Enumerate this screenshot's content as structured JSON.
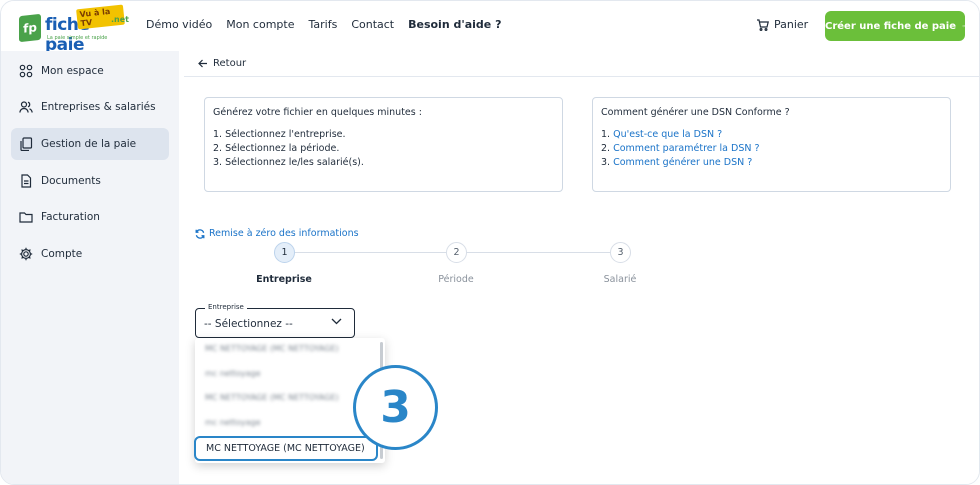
{
  "header": {
    "logo": {
      "initials": "fp",
      "word": "fiche-paie",
      "badge": "Vu à la TV",
      "suffix": ".net",
      "tagline": "La paie simple et rapide"
    },
    "nav": [
      "Démo vidéo",
      "Mon compte",
      "Tarifs",
      "Contact",
      "Besoin d'aide ?"
    ],
    "cart_label": "Panier",
    "cta_label": "Créer une fiche de paie"
  },
  "sidebar": {
    "items": [
      {
        "label": "Mon espace",
        "icon": "grid-icon"
      },
      {
        "label": "Entreprises & salariés",
        "icon": "users-icon"
      },
      {
        "label": "Gestion de la paie",
        "icon": "copy-icon",
        "active": true
      },
      {
        "label": "Documents",
        "icon": "document-icon"
      },
      {
        "label": "Facturation",
        "icon": "folder-icon"
      },
      {
        "label": "Compte",
        "icon": "gear-icon"
      }
    ]
  },
  "main": {
    "back_label": "Retour",
    "info_left": {
      "title": "Générez votre fichier en quelques minutes :",
      "lines": [
        "1. Sélectionnez l'entreprise.",
        "2. Sélectionnez la période.",
        "3. Sélectionnez le/les salarié(s)."
      ]
    },
    "info_right": {
      "title": "Comment générer une DSN Conforme ?",
      "lines": [
        {
          "num": "1.",
          "link": "Qu'est-ce que la DSN ?"
        },
        {
          "num": "2.",
          "link": "Comment paramétrer la DSN ?"
        },
        {
          "num": "3.",
          "link": "Comment générer une DSN ?"
        }
      ]
    },
    "reset_label": "Remise à zéro des informations",
    "steps": [
      {
        "num": "1",
        "label": "Entreprise",
        "active": true
      },
      {
        "num": "2",
        "label": "Période",
        "active": false
      },
      {
        "num": "3",
        "label": "Salarié",
        "active": false
      }
    ],
    "select": {
      "legend": "Entreprise",
      "value": "-- Sélectionnez --"
    },
    "dropdown_options": [
      "MC NETTOYAGE (MC NETTOYAGE)",
      "mc nettoyage",
      "MC NETTOYAGE (MC NETTOYAGE)",
      "mc nettoyage"
    ],
    "highlighted_option": "MC NETTOYAGE (MC NETTOYAGE)",
    "callout_number": "3"
  },
  "colors": {
    "accent_blue": "#2a86c8",
    "cta_green": "#6bbf3a",
    "link_blue": "#1a73c8",
    "sidebar_bg": "#f2f4f8"
  }
}
